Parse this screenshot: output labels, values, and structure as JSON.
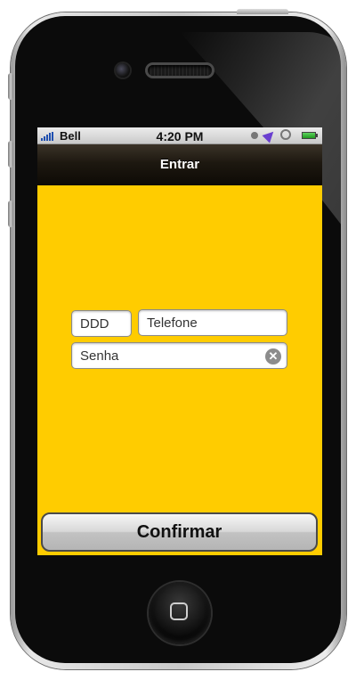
{
  "status_bar": {
    "carrier": "Bell",
    "time": "4:20 PM",
    "icons": [
      "signal-bars-icon",
      "moon-icon",
      "location-arrow-icon",
      "rotation-lock-icon",
      "battery-icon"
    ]
  },
  "nav": {
    "title": "Entrar"
  },
  "form": {
    "ddd_placeholder": "DDD",
    "phone_placeholder": "Telefone",
    "password_value": "Senha",
    "clear_glyph": "✕"
  },
  "actions": {
    "confirm_label": "Confirmar"
  },
  "colors": {
    "screen_background": "#ffcc00",
    "nav_bar": "#1d1810"
  }
}
